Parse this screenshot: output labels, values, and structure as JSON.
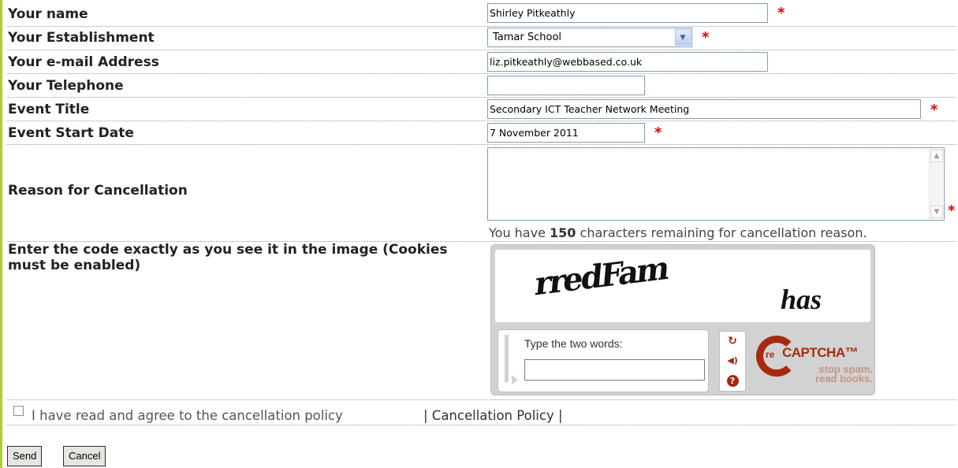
{
  "form": {
    "name": {
      "label": "Your name",
      "value": "Shirley Pitkeathly"
    },
    "establishment": {
      "label": "Your Establishment",
      "value": "Tamar School"
    },
    "email": {
      "label": "Your e-mail Address",
      "value": "liz.pitkeathly@webbased.co.uk"
    },
    "telephone": {
      "label": "Your Telephone",
      "value": ""
    },
    "event_title": {
      "label": "Event Title",
      "value": "Secondary ICT Teacher Network Meeting"
    },
    "event_start": {
      "label": "Event Start Date",
      "value": "7 November 2011"
    },
    "reason": {
      "label": "Reason for Cancellation",
      "value": ""
    },
    "counter": {
      "prefix": "You have",
      "count": "150",
      "suffix": "characters remaining for cancellation reason."
    },
    "required_marker": "*"
  },
  "captcha": {
    "label": "Enter the code exactly as you see it in the image (Cookies must be enabled)",
    "word1": "rredFam",
    "word2": "has",
    "prompt": "Type the two words:",
    "logo_re": "re",
    "logo_name": "CAPTCHA™",
    "logo_tagline_1": "stop spam.",
    "logo_tagline_2": "read books.",
    "icons": [
      "refresh-icon",
      "audio-icon",
      "help-icon"
    ]
  },
  "agreement": {
    "text": "I have read and agree to the cancellation policy",
    "link": "| Cancellation Policy |"
  },
  "buttons": {
    "send": "Send",
    "cancel": "Cancel"
  },
  "colors": {
    "required": "#e30000",
    "accent_bar": "#a8cf3a",
    "recaptcha": "#a72a10"
  }
}
